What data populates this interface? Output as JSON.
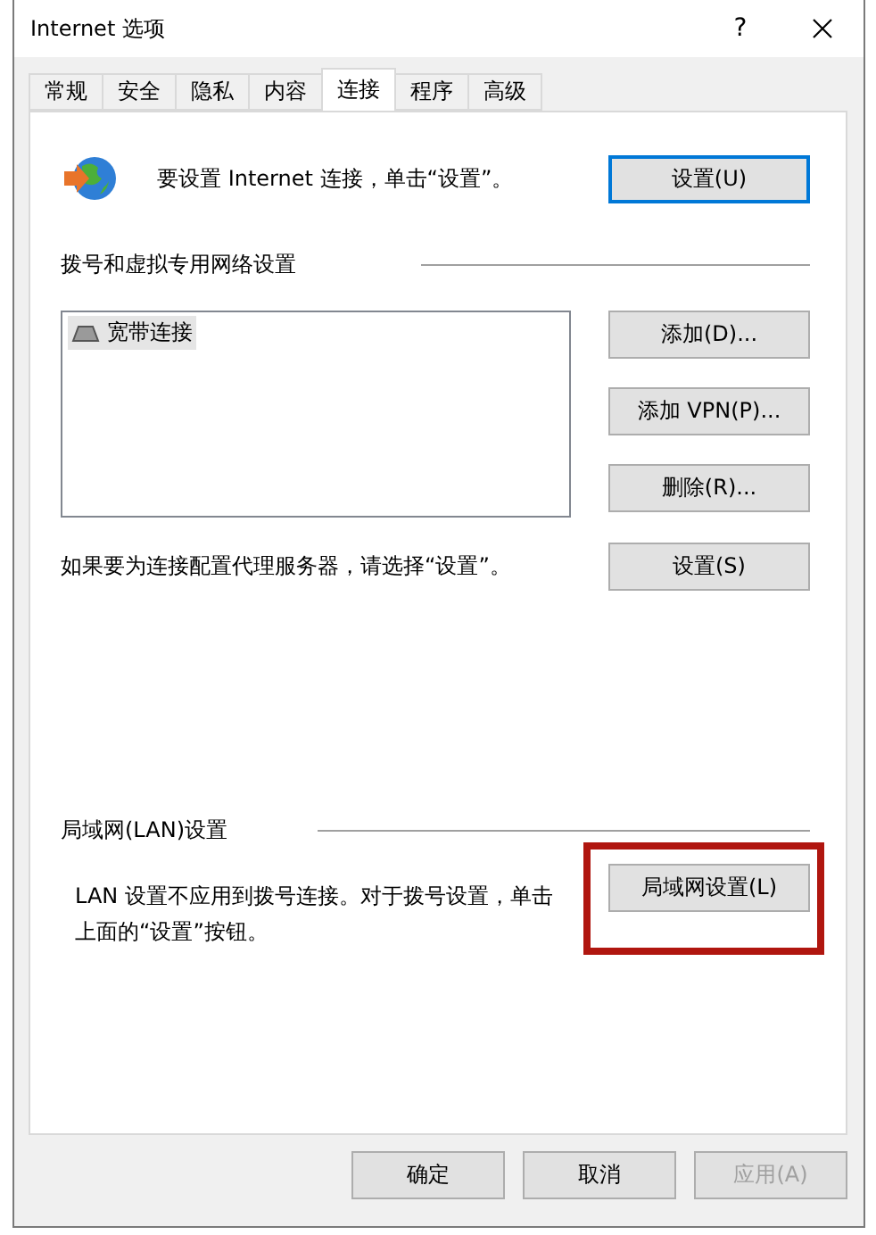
{
  "window": {
    "title": "Internet 选项",
    "help": "?"
  },
  "tabs": [
    {
      "label": "常规",
      "selected": false
    },
    {
      "label": "安全",
      "selected": false
    },
    {
      "label": "隐私",
      "selected": false
    },
    {
      "label": "内容",
      "selected": false
    },
    {
      "label": "连接",
      "selected": true
    },
    {
      "label": "程序",
      "selected": false
    },
    {
      "label": "高级",
      "selected": false
    }
  ],
  "setup": {
    "text": "要设置 Internet 连接，单击“设置”。",
    "button": {
      "label": "设置(U)",
      "default": true
    }
  },
  "dialup": {
    "heading": "拨号和虚拟专用网络设置",
    "connections": [
      {
        "name": "宽带连接",
        "selected": true
      }
    ],
    "buttons": [
      {
        "label": "添加(D)..."
      },
      {
        "label": "添加 VPN(P)..."
      },
      {
        "label": "删除(R)..."
      }
    ],
    "proxy_text": "如果要为连接配置代理服务器，请选择“设置”。",
    "proxy_button": "设置(S)"
  },
  "lan": {
    "heading": "局域网(LAN)设置",
    "text": "LAN 设置不应用到拨号连接。对于拨号设置，单击上面的“设置”按钮。",
    "button": "局域网设置(L)",
    "highlighted": true
  },
  "footer": [
    {
      "label": "确定",
      "disabled": false
    },
    {
      "label": "取消",
      "disabled": false
    },
    {
      "label": "应用(A)",
      "disabled": true
    }
  ]
}
